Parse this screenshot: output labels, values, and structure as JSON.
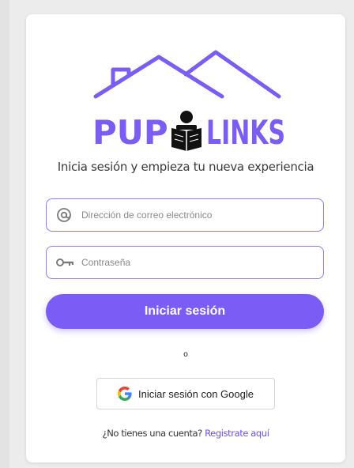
{
  "brand": {
    "name_left": "PUP",
    "name_right": "LINKS",
    "color": "#7b5cf5"
  },
  "subtitle": "Inicia sesión y empieza tu nueva experiencia",
  "email": {
    "placeholder": "Dirección de correo electrónico",
    "value": "",
    "icon": "at-icon"
  },
  "password": {
    "placeholder": "Contraseña",
    "value": "",
    "icon": "key-icon"
  },
  "login_button": "Iniciar sesión",
  "separator": "o",
  "google_button": {
    "label": "Iniciar sesión con Google",
    "icon": "google-icon"
  },
  "signup": {
    "prompt": "¿No tienes una cuenta?",
    "link": "Registrate aquí"
  },
  "colors": {
    "accent": "#7b5cf5",
    "field_border": "#8f7bf4",
    "background": "#ececec"
  }
}
